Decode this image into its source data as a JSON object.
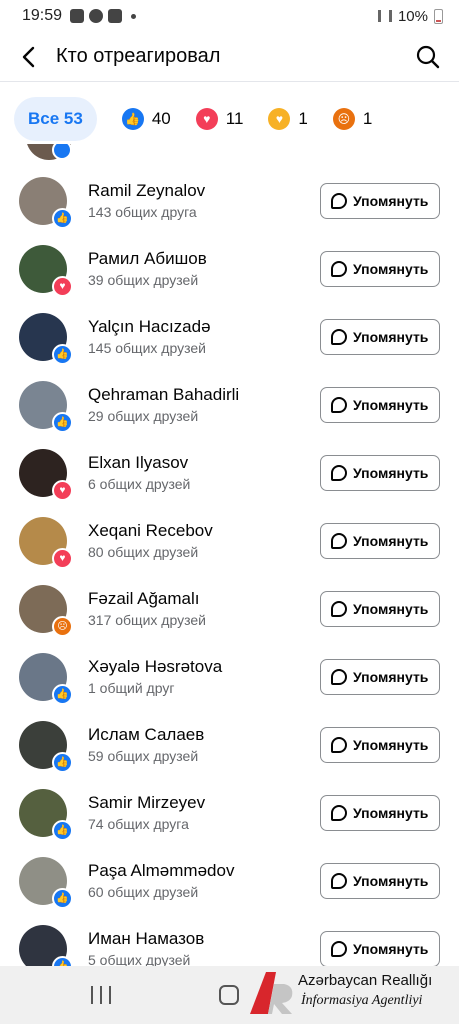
{
  "status_bar": {
    "time": "19:59",
    "battery": "10%"
  },
  "header": {
    "title": "Кто отреагировал"
  },
  "tabs": {
    "all_label": "Все 53",
    "like_count": "40",
    "love_count": "11",
    "care_count": "1",
    "angry_count": "1"
  },
  "mention_label": "Упомянуть",
  "people": [
    {
      "name": "Ramil Zeynalov",
      "mutual": "143 общих друга",
      "reaction": "like",
      "avatar_color": "#8a7f75"
    },
    {
      "name": "Рамил Абишов",
      "mutual": "39 общих друзей",
      "reaction": "love",
      "avatar_color": "#3e5a3a"
    },
    {
      "name": "Yalçın Hacızadə",
      "mutual": "145 общих друзей",
      "reaction": "like",
      "avatar_color": "#27364f"
    },
    {
      "name": "Qehraman Bahadirli",
      "mutual": "29 общих друзей",
      "reaction": "like",
      "avatar_color": "#7a8592"
    },
    {
      "name": "Elxan Ilyasov",
      "mutual": "6 общих друзей",
      "reaction": "love",
      "avatar_color": "#2d2320"
    },
    {
      "name": "Xeqani Recebov",
      "mutual": "80 общих друзей",
      "reaction": "love",
      "avatar_color": "#b58a4a"
    },
    {
      "name": "Fəzail Ağamalı",
      "mutual": "317 общих друзей",
      "reaction": "angry",
      "avatar_color": "#7d6b57"
    },
    {
      "name": "Xəyalə Həsrətova",
      "mutual": "1 общий друг",
      "reaction": "like",
      "avatar_color": "#6a7788"
    },
    {
      "name": "Ислам Салаев",
      "mutual": "59 общих друзей",
      "reaction": "like",
      "avatar_color": "#3b3f3a"
    },
    {
      "name": "Samir Mirzeyev",
      "mutual": "74 общих друга",
      "reaction": "like",
      "avatar_color": "#55603f"
    },
    {
      "name": "Paşa Alməmmədov",
      "mutual": "60 общих друзей",
      "reaction": "like",
      "avatar_color": "#8f8f86"
    },
    {
      "name": "Иман Намазов",
      "mutual": "5 общих друзей",
      "reaction": "like",
      "avatar_color": "#2f3440"
    }
  ],
  "watermark": {
    "line1": "Azərbaycan Reallığı",
    "line2": "İnformasiya Agentliyi"
  },
  "colors": {
    "accent": "#1877f2",
    "like": "#1877f2",
    "love": "#f33e58",
    "angry": "#e9710f",
    "care": "#f7b125"
  }
}
